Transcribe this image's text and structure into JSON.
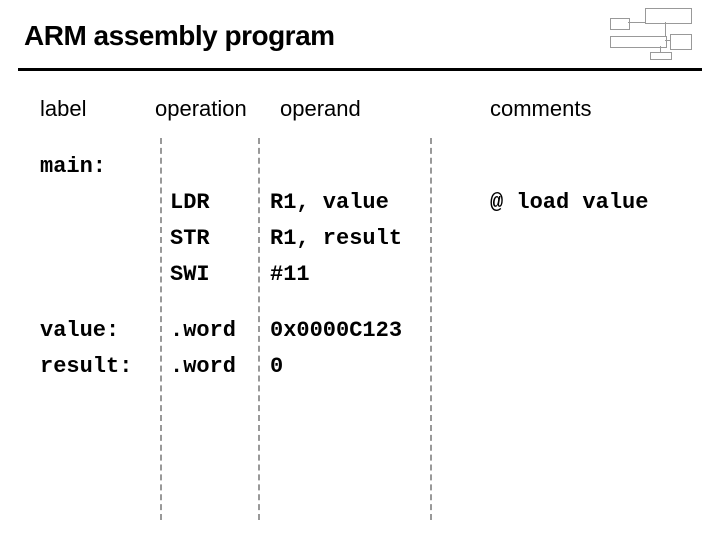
{
  "title": "ARM assembly program",
  "headers": {
    "label": "label",
    "operation": "operation",
    "operand": "operand",
    "comments": "comments"
  },
  "code": {
    "main_label": "main:",
    "r1": {
      "op": "LDR",
      "operand": "R1, value",
      "comment": "@ load value"
    },
    "r2": {
      "op": "STR",
      "operand": "R1, result"
    },
    "r3": {
      "op": "SWI",
      "operand": "#11"
    },
    "r4": {
      "label": "value:",
      "op": ".word",
      "operand": "0x0000C123"
    },
    "r5": {
      "label": "result:",
      "op": ".word",
      "operand": "0"
    }
  }
}
